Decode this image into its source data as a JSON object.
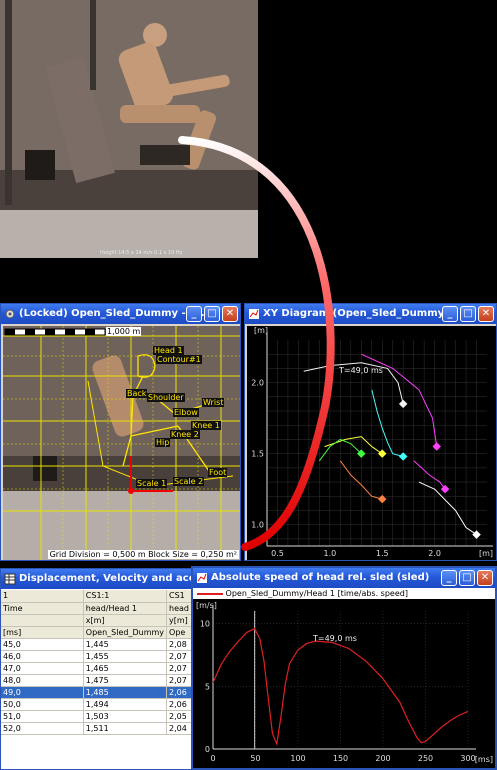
{
  "video": {
    "caption": "Height 14:5 x 14 m/s 0.1 s 10 Hz"
  },
  "tracking_window": {
    "title": "(Locked) Open_Sled_Dummy - fr...",
    "scale_label": "1,000 m",
    "status": "Grid Division = 0,500 m  Block Size = 0,250 m²",
    "markers": [
      "Head 1",
      "Contour#1",
      "Back",
      "Shoulder",
      "Wrist",
      "Elbow",
      "Knee 1",
      "Knee 2",
      "Hip",
      "Foot",
      "Scale 1",
      "Scale 2"
    ]
  },
  "xy_window": {
    "title": "XY Diagram (Open_Sled_Dummy)",
    "y_unit": "[m]",
    "x_unit": "[m]",
    "annotation": "T=49,0 ms",
    "x_ticks": [
      "0.5",
      "1.0",
      "1.5",
      "2.0"
    ],
    "y_ticks": [
      "1.0",
      "1.5",
      "2.0"
    ]
  },
  "table_window": {
    "title": "Displacement, Velocity and accelera...",
    "header_rows": [
      [
        "1",
        "CS1:1",
        "CS1"
      ],
      [
        "Time",
        "head/Head 1",
        "head"
      ],
      [
        "",
        "x[m]",
        "y[m]"
      ],
      [
        "[ms]",
        "Open_Sled_Dummy",
        "Ope"
      ]
    ],
    "rows": [
      [
        "45,0",
        "1,445",
        "2,08"
      ],
      [
        "46,0",
        "1,455",
        "2,07"
      ],
      [
        "47,0",
        "1,465",
        "2,07"
      ],
      [
        "48,0",
        "1,475",
        "2,07"
      ],
      [
        "49,0",
        "1,485",
        "2,06"
      ],
      [
        "50,0",
        "1,494",
        "2,06"
      ],
      [
        "51,0",
        "1,503",
        "2,05"
      ],
      [
        "52,0",
        "1,511",
        "2,04"
      ]
    ],
    "selected_row": 4
  },
  "speed_window": {
    "title": "Absolute speed of head rel. sled (sled)",
    "legend": "Open_Sled_Dummy/Head 1 [time/abs. speed]",
    "y_unit": "[m/s]",
    "x_unit": "[ms]",
    "annotation": "T=49,0 ms"
  },
  "chart_data": [
    {
      "type": "line",
      "title": "Absolute speed of head rel. sled (sled)",
      "xlabel": "[ms]",
      "ylabel": "[m/s]",
      "xlim": [
        0,
        300
      ],
      "ylim": [
        0,
        11
      ],
      "x_ticks": [
        0,
        50,
        100,
        150,
        200,
        250,
        300
      ],
      "y_ticks": [
        0,
        5,
        10
      ],
      "grid": true,
      "series": [
        {
          "name": "Open_Sled_Dummy/Head 1 [time/abs. speed]",
          "color": "#e02020",
          "x": [
            0,
            10,
            20,
            30,
            40,
            49,
            55,
            60,
            65,
            70,
            75,
            80,
            85,
            90,
            100,
            110,
            120,
            140,
            160,
            180,
            200,
            220,
            230,
            240,
            245,
            250,
            260,
            270,
            280,
            290,
            300
          ],
          "y": [
            5.3,
            6.8,
            7.8,
            8.6,
            9.3,
            9.6,
            8.8,
            7.0,
            4.0,
            1.2,
            0.4,
            2.6,
            5.2,
            6.8,
            7.9,
            8.4,
            8.6,
            8.5,
            8.0,
            7.0,
            5.6,
            3.7,
            2.2,
            0.9,
            0.5,
            0.6,
            1.2,
            1.8,
            2.3,
            2.7,
            3.0
          ]
        }
      ],
      "marker_time": 49.0
    },
    {
      "type": "line",
      "title": "XY Diagram (Open_Sled_Dummy)",
      "xlabel": "[m]",
      "ylabel": "[m]",
      "xlim": [
        0.4,
        2.5
      ],
      "ylim": [
        0.85,
        2.3
      ],
      "grid": true,
      "series": [
        {
          "color": "#f0f0f0",
          "x": [
            0.75,
            1.0,
            1.3,
            1.55,
            1.65,
            1.7
          ],
          "y": [
            2.08,
            2.12,
            2.14,
            2.1,
            2.0,
            1.85
          ]
        },
        {
          "color": "#ff40ff",
          "x": [
            1.3,
            1.6,
            1.85,
            1.98,
            2.02
          ],
          "y": [
            2.2,
            2.1,
            1.95,
            1.75,
            1.55
          ]
        },
        {
          "color": "#40ffff",
          "x": [
            1.4,
            1.45,
            1.5,
            1.55,
            1.6,
            1.7
          ],
          "y": [
            1.95,
            1.8,
            1.68,
            1.58,
            1.5,
            1.48
          ]
        },
        {
          "color": "#ffff40",
          "x": [
            0.95,
            1.15,
            1.3,
            1.4,
            1.5
          ],
          "y": [
            1.55,
            1.6,
            1.62,
            1.55,
            1.5
          ]
        },
        {
          "color": "#40ff40",
          "x": [
            0.9,
            1.0,
            1.1,
            1.2,
            1.3
          ],
          "y": [
            1.45,
            1.55,
            1.6,
            1.57,
            1.5
          ]
        },
        {
          "color": "#ff40ff",
          "x": [
            1.8,
            1.95,
            2.05,
            2.1
          ],
          "y": [
            1.45,
            1.35,
            1.3,
            1.25
          ]
        },
        {
          "color": "#ff8040",
          "x": [
            1.1,
            1.2,
            1.3,
            1.4,
            1.5
          ],
          "y": [
            1.45,
            1.35,
            1.28,
            1.2,
            1.18
          ]
        },
        {
          "color": "#ffffff",
          "x": [
            1.85,
            2.0,
            2.2,
            2.3,
            2.4
          ],
          "y": [
            1.3,
            1.25,
            1.1,
            0.98,
            0.93
          ]
        }
      ]
    }
  ]
}
